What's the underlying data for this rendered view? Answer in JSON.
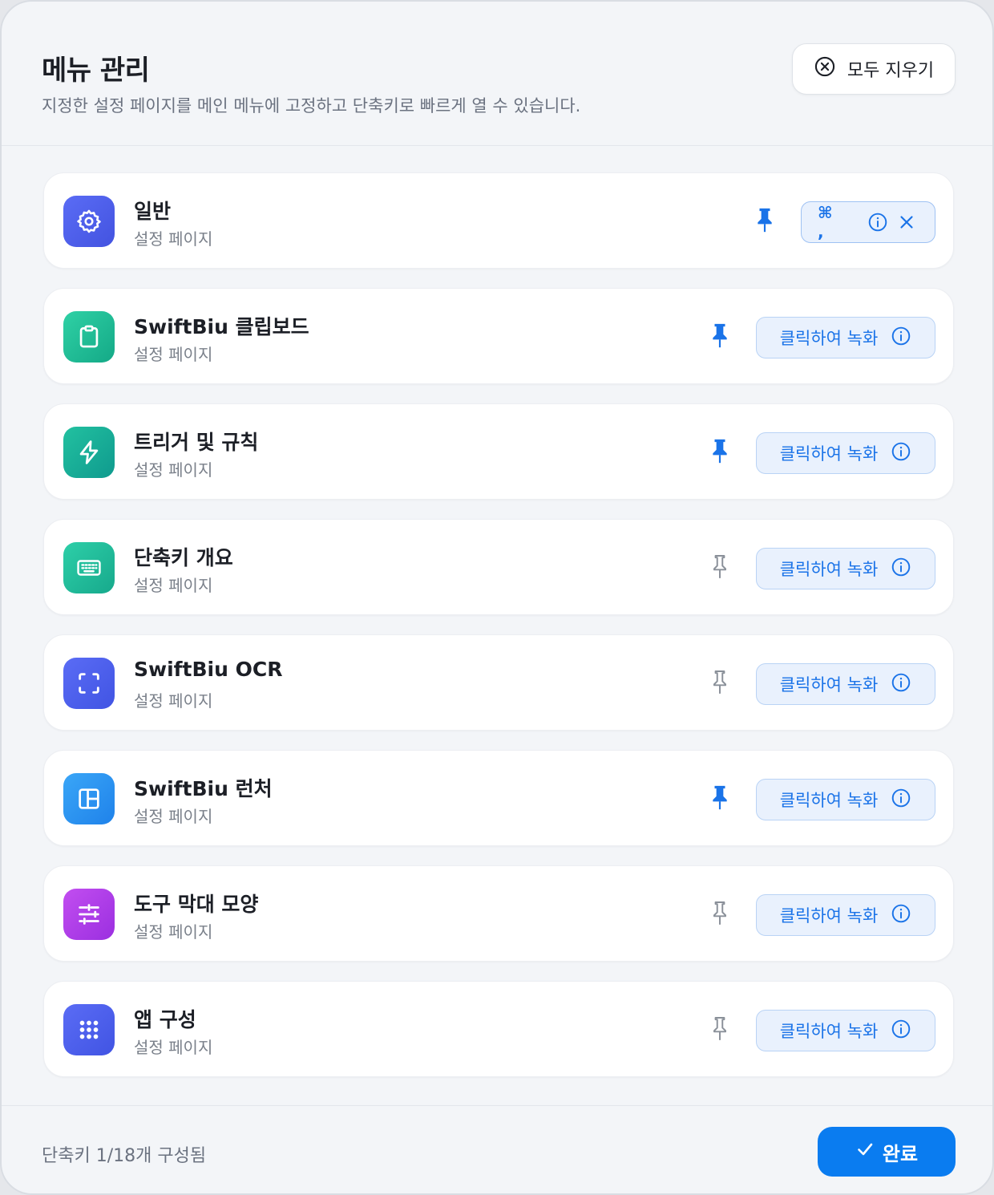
{
  "header": {
    "title": "메뉴 관리",
    "subtitle": "지정한 설정 페이지를 메인 메뉴에 고정하고 단축키로 빠르게 열 수 있습니다.",
    "clear_all_label": "모두 지우기"
  },
  "items": [
    {
      "title": "일반",
      "subtitle": "설정 페이지",
      "icon": "gear-icon",
      "pinned": true,
      "shortcut": "⌘ ,",
      "record_label": ""
    },
    {
      "title": "SwiftBiu 클립보드",
      "subtitle": "설정 페이지",
      "icon": "clipboard-icon",
      "pinned": true,
      "shortcut": "",
      "record_label": "클릭하여 녹화"
    },
    {
      "title": "트리거 및 규칙",
      "subtitle": "설정 페이지",
      "icon": "lightning-icon",
      "pinned": true,
      "shortcut": "",
      "record_label": "클릭하여 녹화"
    },
    {
      "title": "단축키 개요",
      "subtitle": "설정 페이지",
      "icon": "keyboard-icon",
      "pinned": false,
      "shortcut": "",
      "record_label": "클릭하여 녹화"
    },
    {
      "title": "SwiftBiu OCR",
      "subtitle": "설정 페이지",
      "icon": "scan-icon",
      "pinned": false,
      "shortcut": "",
      "record_label": "클릭하여 녹화"
    },
    {
      "title": "SwiftBiu 런처",
      "subtitle": "설정 페이지",
      "icon": "layout-icon",
      "pinned": true,
      "shortcut": "",
      "record_label": "클릭하여 녹화"
    },
    {
      "title": "도구 막대 모양",
      "subtitle": "설정 페이지",
      "icon": "sliders-icon",
      "pinned": false,
      "shortcut": "",
      "record_label": "클릭하여 녹화"
    },
    {
      "title": "앱 구성",
      "subtitle": "설정 페이지",
      "icon": "grid-icon",
      "pinned": false,
      "shortcut": "",
      "record_label": "클릭하여 녹화"
    }
  ],
  "footer": {
    "status": "단축키 1/18개 구성됨",
    "done_label": "완료"
  },
  "colors": {
    "accent": "#1a73e8",
    "primary_button": "#0a7cf0",
    "pin_active": "#1a73e8",
    "pin_inactive": "#8a9099"
  }
}
